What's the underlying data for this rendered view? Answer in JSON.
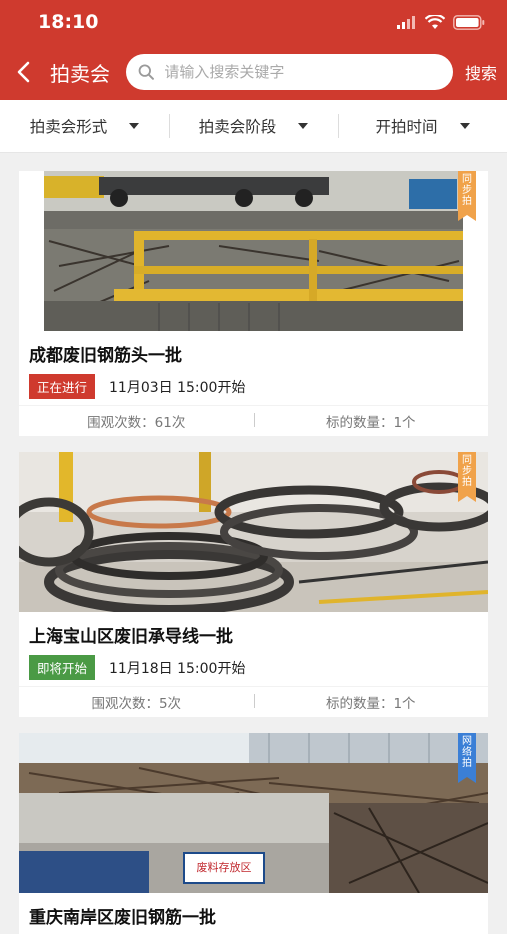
{
  "status_bar": {
    "time": "18:10"
  },
  "header": {
    "title": "拍卖会",
    "search_placeholder": "请输入搜索关键字",
    "search_label": "搜索"
  },
  "filters": [
    {
      "label": "拍卖会形式"
    },
    {
      "label": "拍卖会阶段"
    },
    {
      "label": "开拍时间"
    }
  ],
  "colors": {
    "brand": "#cf3a2e",
    "status_ongoing": "#cf3a2e",
    "status_upcoming": "#4a9a45",
    "ribbon_sync": "#f0a24a",
    "ribbon_online": "#3b7fd6"
  },
  "auctions": [
    {
      "ribbon": "同步拍",
      "title": "成都废旧钢筋头一批",
      "status": "正在进行",
      "start_time": "11月03日 15:00开始",
      "views": "围观次数：61次",
      "lots": "标的数量：1个"
    },
    {
      "ribbon": "同步拍",
      "title": "上海宝山区废旧承导线一批",
      "status": "即将开始",
      "start_time": "11月18日 15:00开始",
      "views": "围观次数：5次",
      "lots": "标的数量：1个"
    },
    {
      "ribbon": "网络拍",
      "title": "重庆南岸区废旧钢筋一批",
      "sign_text": "废料存放区"
    }
  ]
}
